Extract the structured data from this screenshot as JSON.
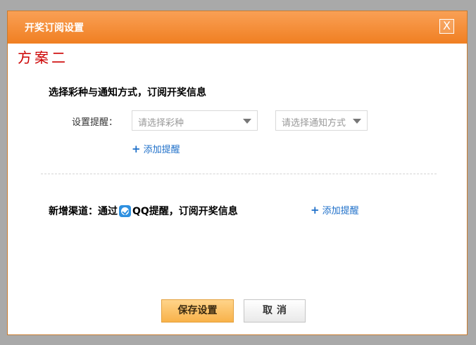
{
  "dialog": {
    "title": "开奖订阅设置",
    "close_glyph": "X",
    "plan_title": "方案二",
    "section_heading": "选择彩种与通知方式，订阅开奖信息",
    "remind_label": "设置提醒：",
    "lottery_select": {
      "placeholder": "请选择彩种"
    },
    "notify_select": {
      "placeholder": "请选择通知方式"
    },
    "add_reminder_plus": "+",
    "add_reminder_label": "添加提醒",
    "channel_prefix": "新增渠道：通过",
    "channel_suffix": "QQ提醒，订阅开奖信息",
    "save_label": "保存设置",
    "cancel_label": "取消"
  },
  "icons": {
    "close": "close-icon",
    "qq": "qq-icon",
    "dropdown": "chevron-down-icon",
    "plus": "plus-icon"
  },
  "colors": {
    "titlebar": "#f07f22",
    "plan_title": "#cc0000",
    "link": "#1e6fc9",
    "save_button": "#f8b24a"
  }
}
